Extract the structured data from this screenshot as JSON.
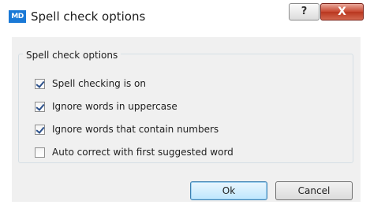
{
  "window": {
    "title": "Spell check options",
    "app_icon_text": "MD",
    "help_glyph": "?",
    "close_glyph": "X"
  },
  "group": {
    "label": "Spell check options"
  },
  "options": [
    {
      "label": "Spell checking is on",
      "checked": true
    },
    {
      "label": "Ignore words in uppercase",
      "checked": true
    },
    {
      "label": "Ignore words that contain numbers",
      "checked": true
    },
    {
      "label": "Auto correct with first suggested word",
      "checked": false
    }
  ],
  "buttons": {
    "ok": "Ok",
    "cancel": "Cancel"
  },
  "colors": {
    "accent": "#1a79d6",
    "close": "#c7462f"
  }
}
